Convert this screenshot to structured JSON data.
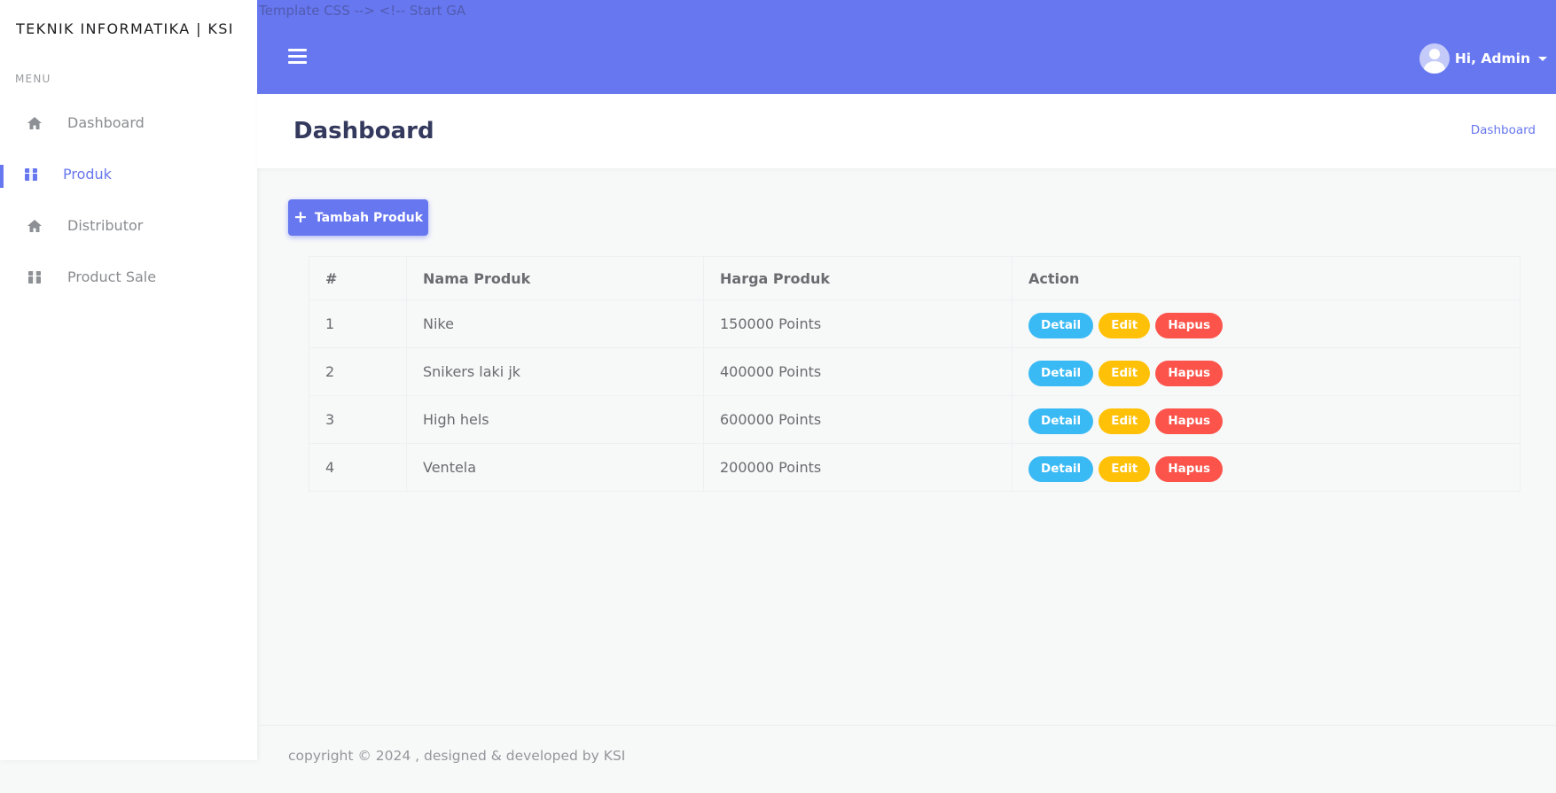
{
  "sidebar": {
    "brand": "TEKNIK INFORMATIKA | KSI",
    "menu_title": "MENU",
    "items": [
      {
        "label": "Dashboard",
        "icon": "home-icon",
        "active": false
      },
      {
        "label": "Produk",
        "icon": "box-icon",
        "active": true
      },
      {
        "label": "Distributor",
        "icon": "home-icon",
        "active": false
      },
      {
        "label": "Product Sale",
        "icon": "box-icon",
        "active": false
      }
    ]
  },
  "topbar": {
    "comment_text": "Template CSS --> <!-- Start GA",
    "hamburger_icon": "bars-icon",
    "user_label": "Hi, Admin",
    "accent_color": "#6777ef"
  },
  "header": {
    "title": "Dashboard",
    "breadcrumb": "Dashboard"
  },
  "actions": {
    "add_label": "Tambah Produk"
  },
  "table": {
    "headers": [
      "#",
      "Nama Produk",
      "Harga Produk",
      "Action"
    ],
    "rows": [
      {
        "no": "1",
        "name": "Nike",
        "price": "150000 Points"
      },
      {
        "no": "2",
        "name": "Snikers laki jk",
        "price": "400000 Points"
      },
      {
        "no": "3",
        "name": "High hels",
        "price": "600000 Points"
      },
      {
        "no": "4",
        "name": "Ventela",
        "price": "200000 Points"
      }
    ],
    "action_labels": {
      "detail": "Detail",
      "edit": "Edit",
      "hapus": "Hapus"
    },
    "action_colors": {
      "detail": "#3abaf4",
      "edit": "#ffc107",
      "hapus": "#fc544b"
    }
  },
  "footer": {
    "text": "copyright © 2024 , designed & developed by KSI"
  }
}
